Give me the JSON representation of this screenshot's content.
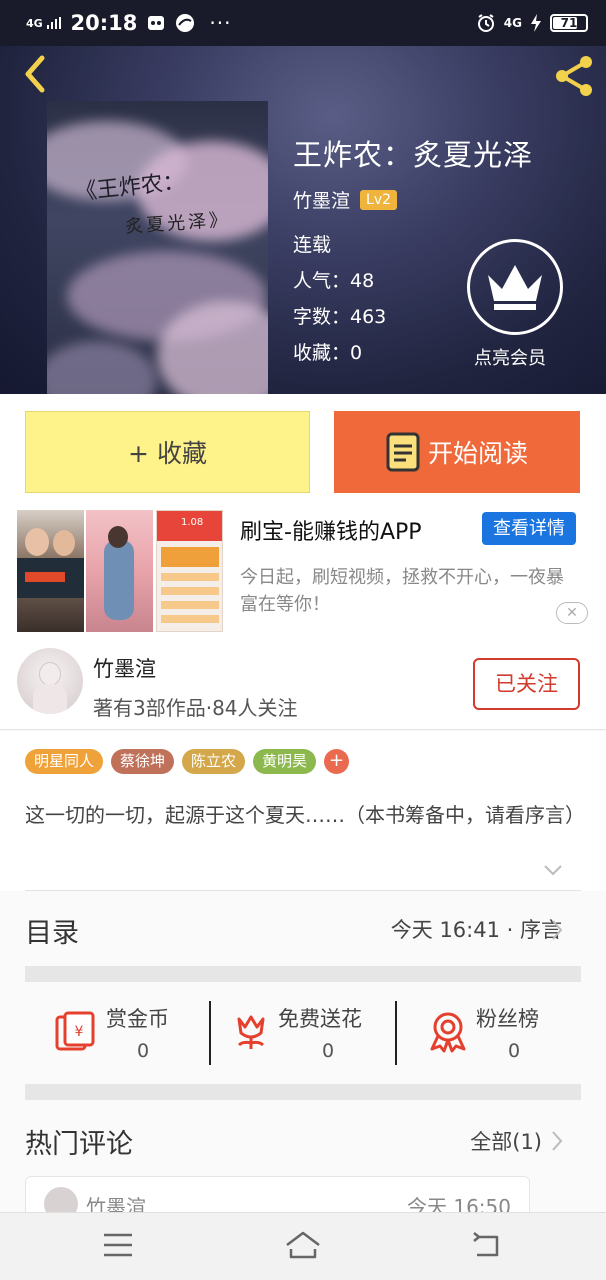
{
  "status_bar": {
    "network_left": "4G",
    "time": "20:18",
    "dots": "···",
    "network_right": "4G",
    "battery": "71"
  },
  "book": {
    "cover_title_line1": "《王炸农：",
    "cover_title_line2": "炙夏光泽》",
    "title": "王炸农：炙夏光泽",
    "author": "竹墨渲",
    "level": "Lv2",
    "status": "连载",
    "popularity": "人气：48",
    "word_count": "字数：463",
    "favorites": "收藏：0",
    "member_label": "点亮会员"
  },
  "actions": {
    "collect_label": "+ 收藏",
    "read_label": "开始阅读"
  },
  "ad": {
    "title": "刷宝-能赚钱的APP",
    "detail_button": "查看详情",
    "description": "今日起，刷短视频，拯救不开心，一夜暴富在等你！",
    "close_label": "✕",
    "image_money": "1.08"
  },
  "author_card": {
    "name": "竹墨渲",
    "info": "著有3部作品·84人关注",
    "follow_label": "已关注"
  },
  "tags": [
    {
      "label": "明星同人",
      "color": "#f0a23a"
    },
    {
      "label": "蔡徐坤",
      "color": "#c0715a"
    },
    {
      "label": "陈立农",
      "color": "#d4a74a"
    },
    {
      "label": "黄明昊",
      "color": "#8cb84e"
    }
  ],
  "tag_add": "+",
  "intro": {
    "text": "这一切的一切，起源于这个夏天……（本书筹备中，请看序言）"
  },
  "toc": {
    "title": "目录",
    "latest": "今天 16:41 · 序言"
  },
  "stats": [
    {
      "label": "赏金币",
      "value": "0",
      "icon": "red-envelope-icon"
    },
    {
      "label": "免费送花",
      "value": "0",
      "icon": "flower-icon"
    },
    {
      "label": "粉丝榜",
      "value": "0",
      "icon": "medal-icon"
    }
  ],
  "comments": {
    "title": "热门评论",
    "all_label": "全部(1)",
    "first_user": "竹墨渲",
    "first_time": "今天 16:50"
  },
  "colors": {
    "accent_orange": "#f0693a",
    "collect_yellow": "#fef28a",
    "follow_red": "#d23a2b",
    "ad_blue": "#1a75e0"
  }
}
